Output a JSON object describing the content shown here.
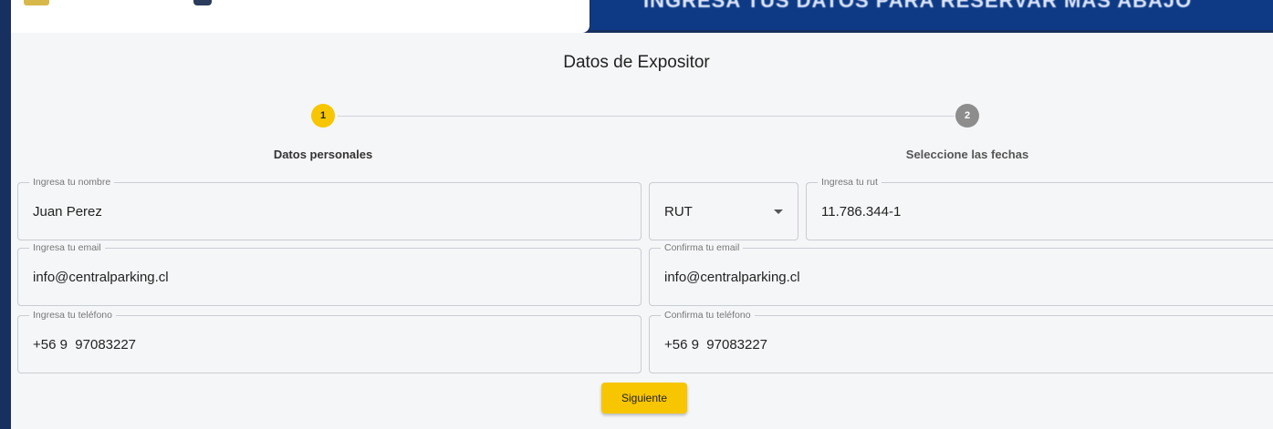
{
  "header": {
    "banner_text": "INGRESA TUS DATOS PARA RESERVAR MÁS ABAJO"
  },
  "form": {
    "title": "Datos de Expositor",
    "steps": [
      {
        "number": "1",
        "label": "Datos personales",
        "state": "active"
      },
      {
        "number": "2",
        "label": "Seleccione las fechas",
        "state": "inactive"
      }
    ],
    "fields": {
      "nombre": {
        "label": "Ingresa tu nombre",
        "value": "Juan Perez"
      },
      "doc_type": {
        "value": "RUT"
      },
      "rut": {
        "label": "Ingresa tu rut",
        "value": "11.786.344-1"
      },
      "email": {
        "label": "Ingresa tu email",
        "value": "info@centralparking.cl"
      },
      "email_confirm": {
        "label": "Confirma tu email",
        "value": "info@centralparking.cl"
      },
      "telefono": {
        "label": "Ingresa tu teléfono",
        "value": "+56 9  97083227"
      },
      "telefono_confirm": {
        "label": "Confirma tu teléfono",
        "value": "+56 9  97083227"
      }
    },
    "next_button": "Siguiente"
  },
  "colors": {
    "page_background": "#18305f",
    "banner": "#0e3a85",
    "accent": "#f7c600",
    "inactive_step": "#8d8d8d"
  }
}
